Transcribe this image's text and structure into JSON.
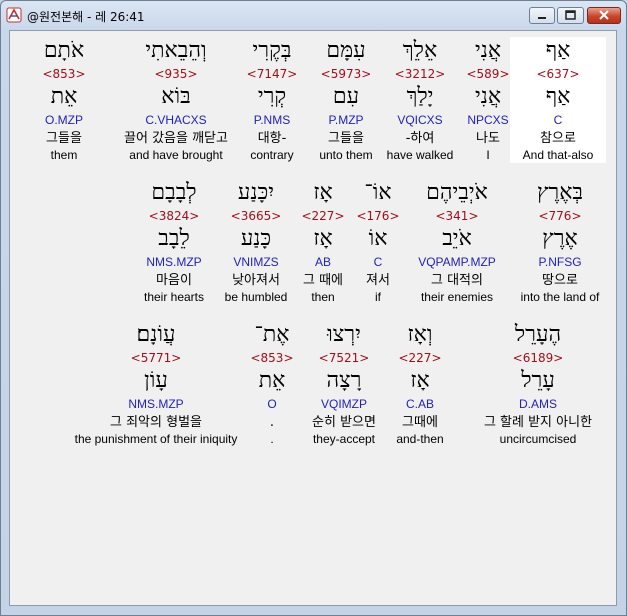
{
  "window": {
    "title": "@원전본해 - 레 26:41"
  },
  "rows": [
    [
      {
        "heb": "אַף",
        "strong": "<637>",
        "lemma": "אַף",
        "morph": "C",
        "kor": "참으로",
        "eng": "And that-also",
        "selected": true
      },
      {
        "heb": "אֲנִי",
        "strong": "<589>",
        "lemma": "אֲנִי",
        "morph": "NPCXS",
        "kor": "나도",
        "eng": "I"
      },
      {
        "heb": "אֵלֵךְ",
        "strong": "<3212>",
        "lemma": "יָלַךְ",
        "morph": "VQICXS",
        "kor": "-하여",
        "eng": "have walked"
      },
      {
        "heb": "עִמָּם",
        "strong": "<5973>",
        "lemma": "עִם",
        "morph": "P.MZP",
        "kor": "그들을",
        "eng": "unto them"
      },
      {
        "heb": "בְּקֶרִי",
        "strong": "<7147>",
        "lemma": "קְרִי",
        "morph": "P.NMS",
        "kor": "대항-",
        "eng": "contrary"
      },
      {
        "heb": "וְהֵבֵאתִי",
        "strong": "<935>",
        "lemma": "בּוֹא",
        "morph": "C.VHACXS",
        "kor": "끌어 갔음을 깨닫고",
        "eng": "and have brought"
      },
      {
        "heb": "אֹתָם",
        "strong": "<853>",
        "lemma": "אֵת",
        "morph": "O.MZP",
        "kor": "그들을",
        "eng": "them"
      }
    ],
    [
      {
        "heb": "בְּאֶרֶץ",
        "strong": "<776>",
        "lemma": "אֶרֶץ",
        "morph": "P.NFSG",
        "kor": "땅으로",
        "eng": "into the land of"
      },
      {
        "heb": "אֹיְבֵיהֶם",
        "strong": "<341>",
        "lemma": "אֹיֵב",
        "morph": "VQPAMP.MZP",
        "kor": "그 대적의",
        "eng": "their enemies"
      },
      {
        "heb": "אוֹ־",
        "strong": "<176>",
        "lemma": "אוֹ",
        "morph": "C",
        "kor": "져서",
        "eng": "if"
      },
      {
        "heb": "אָז",
        "strong": "<227>",
        "lemma": "אָז",
        "morph": "AB",
        "kor": "그 때에",
        "eng": "then"
      },
      {
        "heb": "יִכָּנַע",
        "strong": "<3665>",
        "lemma": "כָּנַע",
        "morph": "VNIMZS",
        "kor": "낮아져서",
        "eng": "be humbled"
      },
      {
        "heb": "לְבָבָם",
        "strong": "<3824>",
        "lemma": "לֵבָב",
        "morph": "NMS.MZP",
        "kor": "마음이",
        "eng": "their hearts"
      }
    ],
    [
      {
        "heb": "הֶעָרֵל",
        "strong": "<6189>",
        "lemma": "עָרֵל",
        "morph": "D.AMS",
        "kor": "그 할례 받지 아니한",
        "eng": "uncircumcised"
      },
      {
        "heb": "וְאָז",
        "strong": "<227>",
        "lemma": "אָז",
        "morph": "C.AB",
        "kor": "그때에",
        "eng": "and-then"
      },
      {
        "heb": "יִרְצוּ",
        "strong": "<7521>",
        "lemma": "רָצָה",
        "morph": "VQIMZP",
        "kor": "순히 받으면",
        "eng": "they-accept"
      },
      {
        "heb": "אֶת־",
        "strong": "<853>",
        "lemma": "אֵת",
        "morph": "O",
        "kor": ".",
        "eng": "."
      },
      {
        "heb": "עֲוֹנָם׃",
        "strong": "<5771>",
        "lemma": "עָוֹן",
        "morph": "NMS.MZP",
        "kor": "그 죄악의 형벌을",
        "eng": "the punishment of their iniquity"
      }
    ]
  ]
}
